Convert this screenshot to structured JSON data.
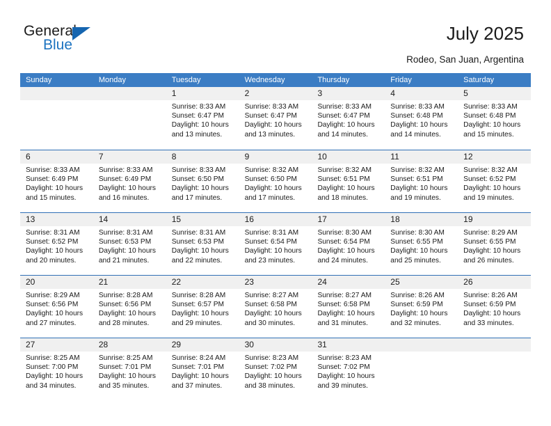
{
  "brand": {
    "name_top": "General",
    "name_bottom": "Blue",
    "accent_color": "#1c73c0",
    "triangle_color": "#1565b0"
  },
  "header": {
    "title": "July 2025",
    "location": "Rodeo, San Juan, Argentina"
  },
  "calendar": {
    "header_bg": "#3b7dc4",
    "row_divider_color": "#2f6fb5",
    "daynum_band_color": "#f0f0f0",
    "weekdays": [
      "Sunday",
      "Monday",
      "Tuesday",
      "Wednesday",
      "Thursday",
      "Friday",
      "Saturday"
    ],
    "weeks": [
      [
        {
          "day": "",
          "empty": true
        },
        {
          "day": "",
          "empty": true
        },
        {
          "day": "1",
          "sunrise": "Sunrise: 8:33 AM",
          "sunset": "Sunset: 6:47 PM",
          "daylight_1": "Daylight: 10 hours",
          "daylight_2": "and 13 minutes."
        },
        {
          "day": "2",
          "sunrise": "Sunrise: 8:33 AM",
          "sunset": "Sunset: 6:47 PM",
          "daylight_1": "Daylight: 10 hours",
          "daylight_2": "and 13 minutes."
        },
        {
          "day": "3",
          "sunrise": "Sunrise: 8:33 AM",
          "sunset": "Sunset: 6:47 PM",
          "daylight_1": "Daylight: 10 hours",
          "daylight_2": "and 14 minutes."
        },
        {
          "day": "4",
          "sunrise": "Sunrise: 8:33 AM",
          "sunset": "Sunset: 6:48 PM",
          "daylight_1": "Daylight: 10 hours",
          "daylight_2": "and 14 minutes."
        },
        {
          "day": "5",
          "sunrise": "Sunrise: 8:33 AM",
          "sunset": "Sunset: 6:48 PM",
          "daylight_1": "Daylight: 10 hours",
          "daylight_2": "and 15 minutes."
        }
      ],
      [
        {
          "day": "6",
          "sunrise": "Sunrise: 8:33 AM",
          "sunset": "Sunset: 6:49 PM",
          "daylight_1": "Daylight: 10 hours",
          "daylight_2": "and 15 minutes."
        },
        {
          "day": "7",
          "sunrise": "Sunrise: 8:33 AM",
          "sunset": "Sunset: 6:49 PM",
          "daylight_1": "Daylight: 10 hours",
          "daylight_2": "and 16 minutes."
        },
        {
          "day": "8",
          "sunrise": "Sunrise: 8:33 AM",
          "sunset": "Sunset: 6:50 PM",
          "daylight_1": "Daylight: 10 hours",
          "daylight_2": "and 17 minutes."
        },
        {
          "day": "9",
          "sunrise": "Sunrise: 8:32 AM",
          "sunset": "Sunset: 6:50 PM",
          "daylight_1": "Daylight: 10 hours",
          "daylight_2": "and 17 minutes."
        },
        {
          "day": "10",
          "sunrise": "Sunrise: 8:32 AM",
          "sunset": "Sunset: 6:51 PM",
          "daylight_1": "Daylight: 10 hours",
          "daylight_2": "and 18 minutes."
        },
        {
          "day": "11",
          "sunrise": "Sunrise: 8:32 AM",
          "sunset": "Sunset: 6:51 PM",
          "daylight_1": "Daylight: 10 hours",
          "daylight_2": "and 19 minutes."
        },
        {
          "day": "12",
          "sunrise": "Sunrise: 8:32 AM",
          "sunset": "Sunset: 6:52 PM",
          "daylight_1": "Daylight: 10 hours",
          "daylight_2": "and 19 minutes."
        }
      ],
      [
        {
          "day": "13",
          "sunrise": "Sunrise: 8:31 AM",
          "sunset": "Sunset: 6:52 PM",
          "daylight_1": "Daylight: 10 hours",
          "daylight_2": "and 20 minutes."
        },
        {
          "day": "14",
          "sunrise": "Sunrise: 8:31 AM",
          "sunset": "Sunset: 6:53 PM",
          "daylight_1": "Daylight: 10 hours",
          "daylight_2": "and 21 minutes."
        },
        {
          "day": "15",
          "sunrise": "Sunrise: 8:31 AM",
          "sunset": "Sunset: 6:53 PM",
          "daylight_1": "Daylight: 10 hours",
          "daylight_2": "and 22 minutes."
        },
        {
          "day": "16",
          "sunrise": "Sunrise: 8:31 AM",
          "sunset": "Sunset: 6:54 PM",
          "daylight_1": "Daylight: 10 hours",
          "daylight_2": "and 23 minutes."
        },
        {
          "day": "17",
          "sunrise": "Sunrise: 8:30 AM",
          "sunset": "Sunset: 6:54 PM",
          "daylight_1": "Daylight: 10 hours",
          "daylight_2": "and 24 minutes."
        },
        {
          "day": "18",
          "sunrise": "Sunrise: 8:30 AM",
          "sunset": "Sunset: 6:55 PM",
          "daylight_1": "Daylight: 10 hours",
          "daylight_2": "and 25 minutes."
        },
        {
          "day": "19",
          "sunrise": "Sunrise: 8:29 AM",
          "sunset": "Sunset: 6:55 PM",
          "daylight_1": "Daylight: 10 hours",
          "daylight_2": "and 26 minutes."
        }
      ],
      [
        {
          "day": "20",
          "sunrise": "Sunrise: 8:29 AM",
          "sunset": "Sunset: 6:56 PM",
          "daylight_1": "Daylight: 10 hours",
          "daylight_2": "and 27 minutes."
        },
        {
          "day": "21",
          "sunrise": "Sunrise: 8:28 AM",
          "sunset": "Sunset: 6:56 PM",
          "daylight_1": "Daylight: 10 hours",
          "daylight_2": "and 28 minutes."
        },
        {
          "day": "22",
          "sunrise": "Sunrise: 8:28 AM",
          "sunset": "Sunset: 6:57 PM",
          "daylight_1": "Daylight: 10 hours",
          "daylight_2": "and 29 minutes."
        },
        {
          "day": "23",
          "sunrise": "Sunrise: 8:27 AM",
          "sunset": "Sunset: 6:58 PM",
          "daylight_1": "Daylight: 10 hours",
          "daylight_2": "and 30 minutes."
        },
        {
          "day": "24",
          "sunrise": "Sunrise: 8:27 AM",
          "sunset": "Sunset: 6:58 PM",
          "daylight_1": "Daylight: 10 hours",
          "daylight_2": "and 31 minutes."
        },
        {
          "day": "25",
          "sunrise": "Sunrise: 8:26 AM",
          "sunset": "Sunset: 6:59 PM",
          "daylight_1": "Daylight: 10 hours",
          "daylight_2": "and 32 minutes."
        },
        {
          "day": "26",
          "sunrise": "Sunrise: 8:26 AM",
          "sunset": "Sunset: 6:59 PM",
          "daylight_1": "Daylight: 10 hours",
          "daylight_2": "and 33 minutes."
        }
      ],
      [
        {
          "day": "27",
          "sunrise": "Sunrise: 8:25 AM",
          "sunset": "Sunset: 7:00 PM",
          "daylight_1": "Daylight: 10 hours",
          "daylight_2": "and 34 minutes."
        },
        {
          "day": "28",
          "sunrise": "Sunrise: 8:25 AM",
          "sunset": "Sunset: 7:01 PM",
          "daylight_1": "Daylight: 10 hours",
          "daylight_2": "and 35 minutes."
        },
        {
          "day": "29",
          "sunrise": "Sunrise: 8:24 AM",
          "sunset": "Sunset: 7:01 PM",
          "daylight_1": "Daylight: 10 hours",
          "daylight_2": "and 37 minutes."
        },
        {
          "day": "30",
          "sunrise": "Sunrise: 8:23 AM",
          "sunset": "Sunset: 7:02 PM",
          "daylight_1": "Daylight: 10 hours",
          "daylight_2": "and 38 minutes."
        },
        {
          "day": "31",
          "sunrise": "Sunrise: 8:23 AM",
          "sunset": "Sunset: 7:02 PM",
          "daylight_1": "Daylight: 10 hours",
          "daylight_2": "and 39 minutes."
        },
        {
          "day": "",
          "empty": true
        },
        {
          "day": "",
          "empty": true
        }
      ]
    ]
  }
}
